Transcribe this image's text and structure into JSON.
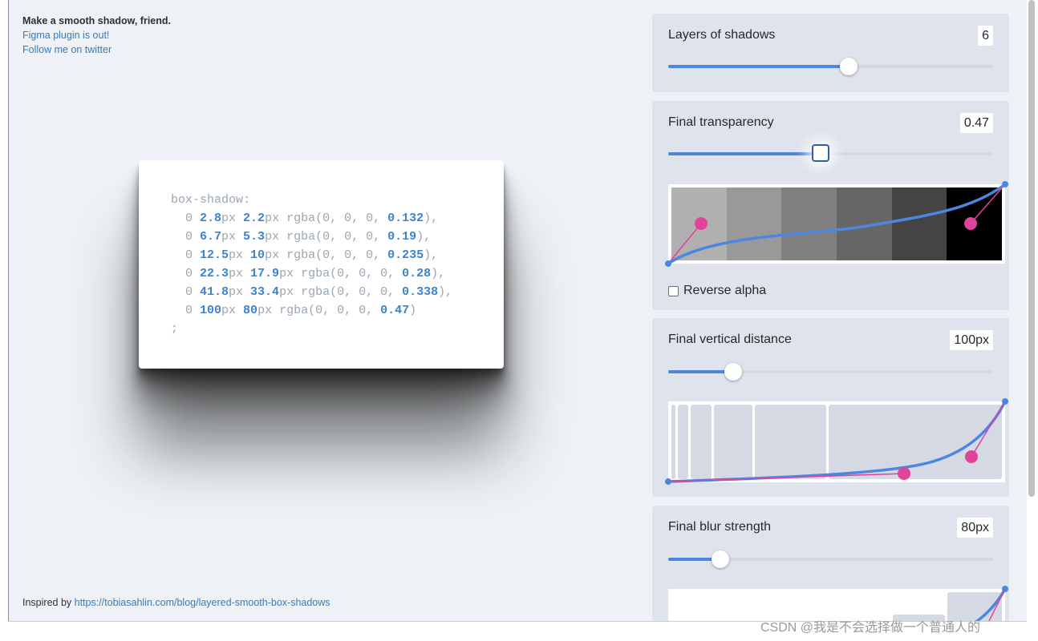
{
  "intro": {
    "tagline": "Make a smooth shadow, friend.",
    "figma_link": "Figma plugin is out!",
    "twitter_link": "Follow me on twitter"
  },
  "footer": {
    "prefix": "Inspired by ",
    "link": "https://tobiasahlin.com/blog/layered-smooth-box-shadows"
  },
  "code": {
    "property": "box-shadow:",
    "layers": [
      {
        "y": "2.8",
        "blur": "2.2",
        "alpha": "0.132",
        "sep": ","
      },
      {
        "y": "6.7",
        "blur": "5.3",
        "alpha": "0.19",
        "sep": ","
      },
      {
        "y": "12.5",
        "blur": "10",
        "alpha": "0.235",
        "sep": ","
      },
      {
        "y": "22.3",
        "blur": "17.9",
        "alpha": "0.28",
        "sep": ","
      },
      {
        "y": "41.8",
        "blur": "33.4",
        "alpha": "0.338",
        "sep": ","
      },
      {
        "y": "100",
        "blur": "80",
        "alpha": "0.47",
        "sep": ""
      }
    ],
    "terminator": ";"
  },
  "controls": {
    "layers": {
      "label": "Layers of shadows",
      "value": "6",
      "level": 0.555
    },
    "transparency": {
      "label": "Final transparency",
      "value": "0.47",
      "level": 0.47
    },
    "reverse_alpha": {
      "label": "Reverse alpha",
      "checked": false
    },
    "distance": {
      "label": "Final vertical distance",
      "value": "100px",
      "level": 0.2
    },
    "blur": {
      "label": "Final blur strength",
      "value": "80px",
      "level": 0.16
    }
  },
  "swatches": [
    "#b0b0b0",
    "#999999",
    "#808080",
    "#666666",
    "#444444",
    "#000000"
  ],
  "colors": {
    "accent": "#4a86e2",
    "handle": "#e0449a",
    "link": "#3a7bb8",
    "panel": "#dee3ec",
    "page": "#eef2f6"
  },
  "watermark": "CSDN @我是不会选择做一个普通人的"
}
